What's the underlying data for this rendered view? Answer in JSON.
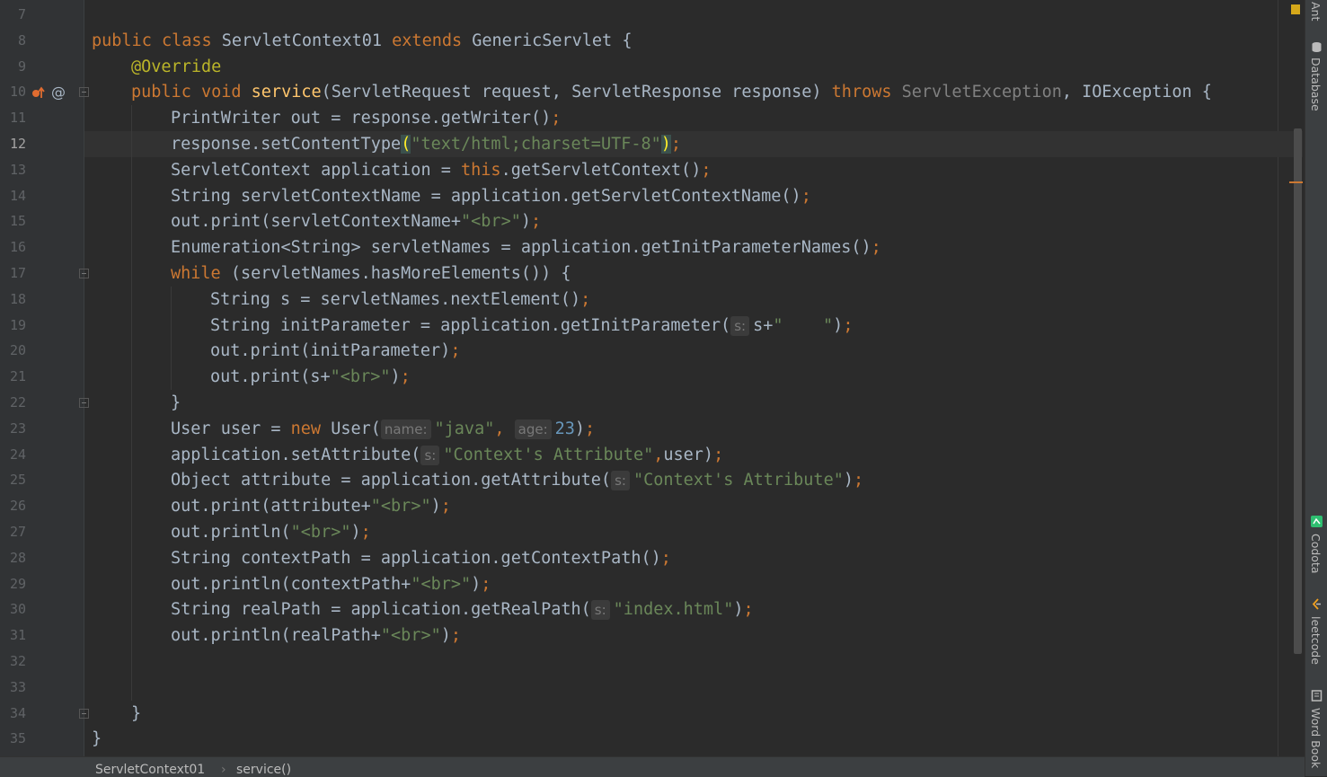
{
  "editor": {
    "current_line": 12,
    "lines": [
      {
        "n": "7"
      },
      {
        "n": "8",
        "tokens": [
          [
            "kw",
            "public class "
          ],
          [
            "",
            "ServletContext01 "
          ],
          [
            "kw",
            "extends "
          ],
          [
            "",
            "GenericServlet {"
          ]
        ]
      },
      {
        "n": "9",
        "indent": 1,
        "tokens": [
          [
            "ann",
            "@Override"
          ]
        ]
      },
      {
        "n": "10",
        "indent": 1,
        "tokens": [
          [
            "kw",
            "public void "
          ],
          [
            "fn",
            "service"
          ],
          [
            "",
            "(ServletRequest request, ServletResponse response) "
          ],
          [
            "kw",
            "throws "
          ],
          [
            "ex",
            "ServletException"
          ],
          [
            "",
            ", IOException {"
          ]
        ]
      },
      {
        "n": "11",
        "indent": 2,
        "tokens": [
          [
            "",
            "PrintWriter out = response.getWriter()"
          ],
          [
            "kw",
            ";"
          ]
        ]
      },
      {
        "n": "12",
        "indent": 2,
        "tokens": [
          [
            "",
            "response.setContentType"
          ],
          [
            "bm",
            "("
          ],
          [
            "str",
            "\"text/html;charset=UTF-8\""
          ],
          [
            "bm",
            ")"
          ],
          [
            "kw",
            ";"
          ]
        ]
      },
      {
        "n": "13",
        "indent": 2,
        "tokens": [
          [
            "",
            "ServletContext application = "
          ],
          [
            "kw",
            "this"
          ],
          [
            "",
            ".getServletContext()"
          ],
          [
            "kw",
            ";"
          ]
        ]
      },
      {
        "n": "14",
        "indent": 2,
        "tokens": [
          [
            "",
            "String servletContextName = application.getServletContextName()"
          ],
          [
            "kw",
            ";"
          ]
        ]
      },
      {
        "n": "15",
        "indent": 2,
        "tokens": [
          [
            "",
            "out.print(servletContextName+"
          ],
          [
            "str",
            "\"<br>\""
          ],
          [
            "",
            ")"
          ],
          [
            "kw",
            ";"
          ]
        ]
      },
      {
        "n": "16",
        "indent": 2,
        "tokens": [
          [
            "",
            "Enumeration<String> servletNames = application.getInitParameterNames()"
          ],
          [
            "kw",
            ";"
          ]
        ]
      },
      {
        "n": "17",
        "indent": 2,
        "tokens": [
          [
            "kw",
            "while "
          ],
          [
            "",
            "(servletNames.hasMoreElements()) {"
          ]
        ]
      },
      {
        "n": "18",
        "indent": 3,
        "tokens": [
          [
            "",
            "String s = servletNames.nextElement()"
          ],
          [
            "kw",
            ";"
          ]
        ]
      },
      {
        "n": "19",
        "indent": 3,
        "tokens": [
          [
            "",
            "String initParameter = application.getInitParameter("
          ],
          [
            "hint",
            "s:"
          ],
          [
            "",
            "s+"
          ],
          [
            "str",
            "\"    \""
          ],
          [
            "",
            ")"
          ],
          [
            "kw",
            ";"
          ]
        ]
      },
      {
        "n": "20",
        "indent": 3,
        "tokens": [
          [
            "",
            "out.print(initParameter)"
          ],
          [
            "kw",
            ";"
          ]
        ]
      },
      {
        "n": "21",
        "indent": 3,
        "tokens": [
          [
            "",
            "out.print(s+"
          ],
          [
            "str",
            "\"<br>\""
          ],
          [
            "",
            ")"
          ],
          [
            "kw",
            ";"
          ]
        ]
      },
      {
        "n": "22",
        "indent": 2,
        "tokens": [
          [
            "",
            "}"
          ]
        ]
      },
      {
        "n": "23",
        "indent": 2,
        "tokens": [
          [
            "",
            "User user = "
          ],
          [
            "kw",
            "new "
          ],
          [
            "",
            "User("
          ],
          [
            "hint",
            "name:"
          ],
          [
            "str",
            "\"java\""
          ],
          [
            "kw",
            ", "
          ],
          [
            "hint",
            "age:"
          ],
          [
            "num",
            "23"
          ],
          [
            "",
            ")"
          ],
          [
            "kw",
            ";"
          ]
        ]
      },
      {
        "n": "24",
        "indent": 2,
        "tokens": [
          [
            "",
            "application.setAttribute("
          ],
          [
            "hint",
            "s:"
          ],
          [
            "str",
            "\"Context's Attribute\""
          ],
          [
            "kw",
            ","
          ],
          [
            "",
            "user)"
          ],
          [
            "kw",
            ";"
          ]
        ]
      },
      {
        "n": "25",
        "indent": 2,
        "tokens": [
          [
            "",
            "Object attribute = application.getAttribute("
          ],
          [
            "hint",
            "s:"
          ],
          [
            "str",
            "\"Context's Attribute\""
          ],
          [
            "",
            ")"
          ],
          [
            "kw",
            ";"
          ]
        ]
      },
      {
        "n": "26",
        "indent": 2,
        "tokens": [
          [
            "",
            "out.print(attribute+"
          ],
          [
            "str",
            "\"<br>\""
          ],
          [
            "",
            ")"
          ],
          [
            "kw",
            ";"
          ]
        ]
      },
      {
        "n": "27",
        "indent": 2,
        "tokens": [
          [
            "",
            "out.println("
          ],
          [
            "str",
            "\"<br>\""
          ],
          [
            "",
            ")"
          ],
          [
            "kw",
            ";"
          ]
        ]
      },
      {
        "n": "28",
        "indent": 2,
        "tokens": [
          [
            "",
            "String contextPath = application.getContextPath()"
          ],
          [
            "kw",
            ";"
          ]
        ]
      },
      {
        "n": "29",
        "indent": 2,
        "tokens": [
          [
            "",
            "out.println(contextPath+"
          ],
          [
            "str",
            "\"<br>\""
          ],
          [
            "",
            ")"
          ],
          [
            "kw",
            ";"
          ]
        ]
      },
      {
        "n": "30",
        "indent": 2,
        "tokens": [
          [
            "",
            "String realPath = application.getRealPath("
          ],
          [
            "hint",
            "s:"
          ],
          [
            "str",
            "\"index.html\""
          ],
          [
            "",
            ")"
          ],
          [
            "kw",
            ";"
          ]
        ]
      },
      {
        "n": "31",
        "indent": 2,
        "tokens": [
          [
            "",
            "out.println(realPath+"
          ],
          [
            "str",
            "\"<br>\""
          ],
          [
            "",
            ")"
          ],
          [
            "kw",
            ";"
          ]
        ]
      },
      {
        "n": "32"
      },
      {
        "n": "33"
      },
      {
        "n": "34",
        "indent": 1,
        "tokens": [
          [
            "",
            "}"
          ]
        ]
      },
      {
        "n": "35",
        "tokens": [
          [
            "",
            "}"
          ]
        ]
      }
    ]
  },
  "gutter_icons": {
    "override": "override-up-arrow-icon",
    "at": "@"
  },
  "tool_windows": [
    "Ant",
    "Database",
    "Codota",
    "leetcode",
    "Word Book"
  ],
  "breadcrumb": {
    "class_name": "ServletContext01",
    "separator": "›",
    "method_name": "service()"
  },
  "colors": {
    "background": "#2b2b2b",
    "keyword": "#cc7832",
    "string": "#6a8759",
    "annotation": "#bbb529",
    "number": "#6897bb",
    "method_declaration": "#ffc66d",
    "plain": "#a9b7c6"
  }
}
